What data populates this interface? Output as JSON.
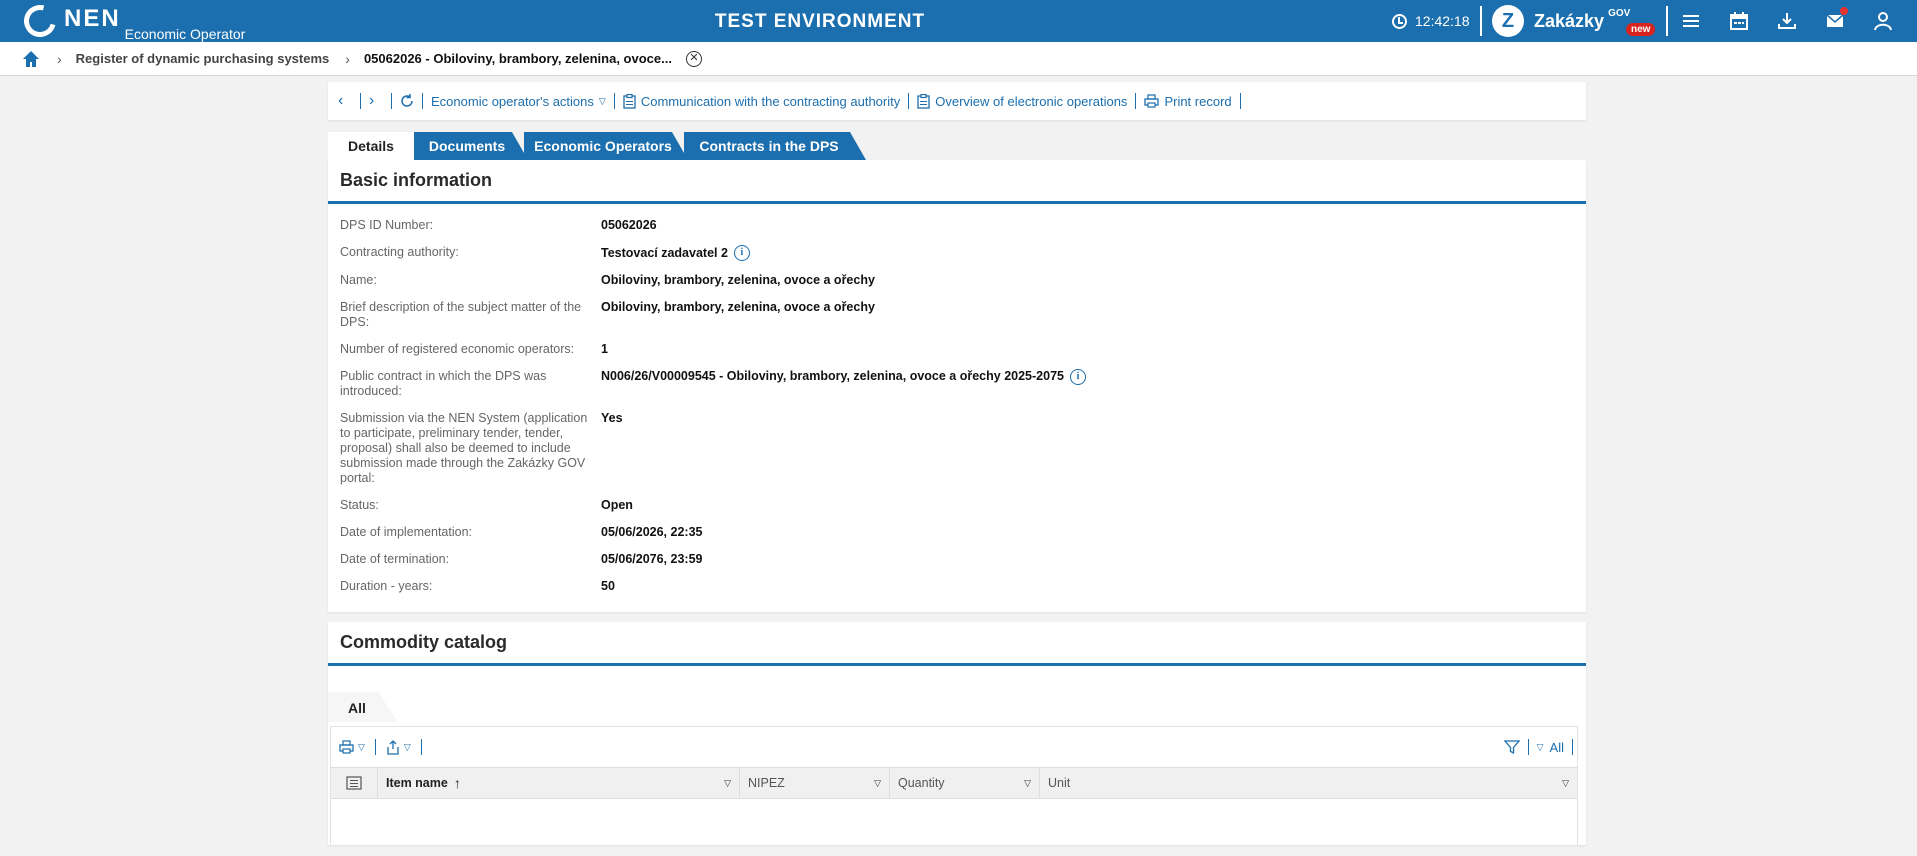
{
  "topbar": {
    "logo_text": "NEN",
    "logo_subtitle": "Economic Operator",
    "environment": "TEST ENVIRONMENT",
    "clock": "12:42:18",
    "portal_name": "Zakázky",
    "portal_gov": "GOV",
    "portal_badge": "new",
    "brand_color": "#1c6fae"
  },
  "breadcrumb": {
    "items": [
      "Register of dynamic purchasing systems"
    ],
    "current": "05062026 - Obiloviny, brambory, zelenina, ovoce..."
  },
  "toolbar": {
    "actions_label": "Economic operator's actions",
    "communication_label": "Communication with the contracting authority",
    "overview_label": "Overview of electronic operations",
    "print_label": "Print record"
  },
  "tabs": [
    "Details",
    "Documents",
    "Economic Operators",
    "Contracts in the DPS"
  ],
  "basic_info": {
    "title": "Basic information",
    "rows": [
      {
        "label": "DPS ID Number:",
        "value": "05062026"
      },
      {
        "label": "Contracting authority:",
        "value": "Testovací zadavatel 2"
      },
      {
        "label": "Name:",
        "value": "Obiloviny, brambory, zelenina, ovoce a ořechy"
      },
      {
        "label": "Brief description of the subject matter of the DPS:",
        "value": "Obiloviny, brambory, zelenina, ovoce a ořechy"
      },
      {
        "label": "Number of registered economic operators:",
        "value": "1"
      },
      {
        "label": "Public contract in which the DPS was introduced:",
        "value": "N006/26/V00009545 - Obiloviny, brambory, zelenina, ovoce a ořechy 2025-2075"
      },
      {
        "label": "Submission via the NEN System (application to participate, preliminary tender, tender, proposal) shall also be deemed to include submission made through the Zakázky GOV portal:",
        "value": "Yes"
      },
      {
        "label": "Status:",
        "value": "Open"
      },
      {
        "label": "Date of implementation:",
        "value": "05/06/2026, 22:35"
      },
      {
        "label": "Date of termination:",
        "value": "05/06/2076, 23:59"
      },
      {
        "label": "Duration - years:",
        "value": "50"
      }
    ]
  },
  "catalog": {
    "title": "Commodity catalog",
    "subtab": "All",
    "filter_label": "All",
    "columns": [
      "Item name",
      "NIPEZ",
      "Quantity",
      "Unit"
    ]
  }
}
